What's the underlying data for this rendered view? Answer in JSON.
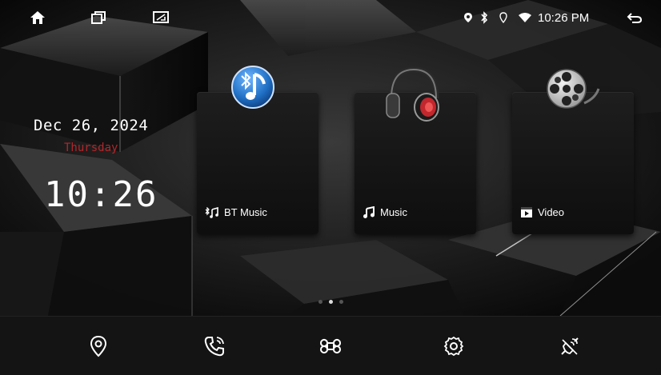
{
  "status": {
    "time": "10:26 PM",
    "icons": [
      "home-icon",
      "recent-apps-icon",
      "screen-mirror-icon",
      "location-pin-icon",
      "bluetooth-icon",
      "voice-icon",
      "wifi-icon",
      "back-icon"
    ]
  },
  "clock": {
    "date": "Dec 26, 2024",
    "weekday": "Thursday",
    "time": "10:26"
  },
  "cards": [
    {
      "label": "BT Music",
      "icon": "bluetooth-music-icon"
    },
    {
      "label": "Music",
      "icon": "headphones-icon"
    },
    {
      "label": "Video",
      "icon": "film-reel-icon"
    }
  ],
  "pager": {
    "pages": 3,
    "active_index": 1
  },
  "dock": [
    "navigation-icon",
    "phone-icon",
    "apps-icon",
    "settings-icon",
    "no-signal-icon"
  ],
  "colors": {
    "accent_red": "#b3262a",
    "dock_bg": "#141414",
    "bt_blue": "#1f6fc4"
  }
}
